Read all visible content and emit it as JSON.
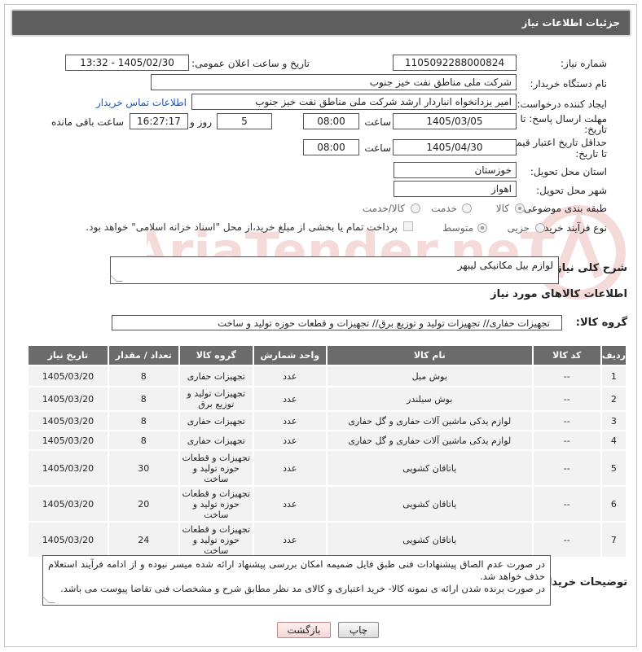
{
  "header": {
    "title": "جزئیات اطلاعات نیاز"
  },
  "fields": {
    "need_number": {
      "label": "شماره نیاز:",
      "value": "1105092288000824"
    },
    "announce_datetime": {
      "label": "تاریخ و ساعت اعلان عمومی:",
      "value": "1405/02/30 - 13:32"
    },
    "buyer_org": {
      "label": "نام دستگاه خریدار:",
      "value": "شرکت ملی مناطق نفت خیز جنوب"
    },
    "requester": {
      "label": "ایجاد کننده درخواست:",
      "value": "امیر یزدانخواه انباردار ارشد شرکت ملی مناطق نفت خیز جنوب",
      "contact_link": "اطلاعات تماس خریدار"
    },
    "reply_deadline": {
      "label_line1": "مهلت ارسال پاسخ: تا",
      "label_line2": "تاریخ:",
      "date": "1405/03/05",
      "time_label": "ساعت",
      "time": "08:00",
      "days": "5",
      "days_label": "روز و",
      "remaining": "16:27:17",
      "remaining_label": "ساعت باقی مانده"
    },
    "price_validity": {
      "label_line1": "حداقل تاریخ اعتبار قیمت:",
      "label_line2": "تا تاریخ:",
      "date": "1405/04/30",
      "time_label": "ساعت",
      "time": "08:00"
    },
    "delivery_province": {
      "label": "استان محل تحویل:",
      "value": "خوزستان"
    },
    "delivery_city": {
      "label": "شهر محل تحویل:",
      "value": "اهواز"
    },
    "category": {
      "label": "طبقه بندی موضوعی:",
      "options": [
        "کالا",
        "خدمت",
        "کالا/خدمت"
      ],
      "selected": "کالا"
    },
    "purchase_type": {
      "label": "نوع فرآیند خرید :",
      "options": [
        "جزیی",
        "متوسط"
      ],
      "selected": "متوسط",
      "payment_note": "پرداخت تمام یا بخشی از مبلغ خرید،از محل \"اسناد خزانه اسلامی\" خواهد بود."
    }
  },
  "summary": {
    "label": "شرح کلی نیاز:",
    "value": "لوازم بیل مکانیکی لیبهر"
  },
  "items_section": {
    "title": "اطلاعات کالاهای مورد نیاز",
    "group_label": "گروه کالا:",
    "group_value": "تجهیزات حفاری// تجهیزات تولید و توزیع برق// تجهیزات و قطعات حوزه تولید و ساخت",
    "columns": [
      "ردیف",
      "کد کالا",
      "نام کالا",
      "واحد شمارش",
      "گروه کالا",
      "تعداد / مقدار",
      "تاریخ نیاز"
    ],
    "rows": [
      [
        "1",
        "--",
        "بوش میل",
        "عدد",
        "تجهیزات حفاری",
        "8",
        "1405/03/20"
      ],
      [
        "2",
        "--",
        "بوش سیلندر",
        "عدد",
        "تجهیزات تولید و توزیع برق",
        "8",
        "1405/03/20"
      ],
      [
        "3",
        "--",
        "لوازم یدکی ماشین آلات حفاری و گل حفاری",
        "عدد",
        "تجهیزات حفاری",
        "8",
        "1405/03/20"
      ],
      [
        "4",
        "--",
        "لوازم یدکی ماشین آلات حفاری و گل حفاری",
        "عدد",
        "تجهیزات حفاری",
        "8",
        "1405/03/20"
      ],
      [
        "5",
        "--",
        "یاتاقان کشویی",
        "عدد",
        "تجهیزات و قطعات حوزه تولید و ساخت",
        "30",
        "1405/03/20"
      ],
      [
        "6",
        "--",
        "یاتاقان کشویی",
        "عدد",
        "تجهیزات و قطعات حوزه تولید و ساخت",
        "20",
        "1405/03/20"
      ],
      [
        "7",
        "--",
        "یاتاقان کشویی",
        "عدد",
        "تجهیزات و قطعات حوزه تولید و ساخت",
        "24",
        "1405/03/20"
      ]
    ]
  },
  "buyer_notes": {
    "label": "توضیحات خریدار:",
    "lines": [
      "در صورت عدم الصاق پیشنهادات فنی طبق فایل ضمیمه امکان بررسی پیشنهاد ارائه شده میسر نبوده و از ادامه فرآیند استعلام حذف خواهد شد.",
      "در صورت برنده شدن ارائه ی نمونه کالا- خرید اعتباری و کالای مد نظر مطابق شرح و مشخصات فنی تقاضا پیوست می باشد."
    ]
  },
  "buttons": {
    "print": "چاپ",
    "back": "بازگشت"
  },
  "watermark": {
    "text": "AriaTender.neT"
  }
}
